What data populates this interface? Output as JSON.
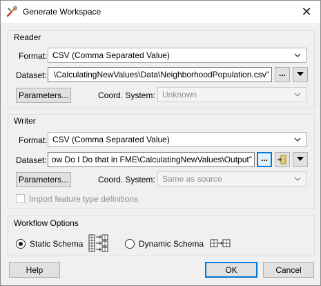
{
  "window": {
    "title": "Generate Workspace",
    "close_glyph": "✕",
    "app_icon": "fme-wrench-icon"
  },
  "reader": {
    "group_label": "Reader",
    "format_label": "Format:",
    "format_value": "CSV (Comma Separated Value)",
    "dataset_label": "Dataset:",
    "dataset_value": "\\CalculatingNewValues\\Data\\NeighborhoodPopulation.csv\"",
    "browse_label": "...",
    "parameters_label": "Parameters...",
    "coord_label": "Coord. System:",
    "coord_value": "Unknown"
  },
  "writer": {
    "group_label": "Writer",
    "format_label": "Format:",
    "format_value": "CSV (Comma Separated Value)",
    "dataset_label": "Dataset:",
    "dataset_value": "ow Do I Do that in FME\\CalculatingNewValues\\Output\"",
    "browse_label": "...",
    "parameters_label": "Parameters...",
    "coord_label": "Coord. System:",
    "coord_value": "Same as source",
    "import_label": "Import feature type definitions",
    "import_checked": false
  },
  "workflow": {
    "group_label": "Workflow Options",
    "static_label": "Static Schema",
    "dynamic_label": "Dynamic Schema",
    "selected": "static"
  },
  "footer": {
    "help_label": "Help",
    "ok_label": "OK",
    "cancel_label": "Cancel"
  },
  "colors": {
    "accent": "#0078d7",
    "dialog_bg": "#f0f0f0",
    "disabled_text": "#8d8d8d"
  }
}
